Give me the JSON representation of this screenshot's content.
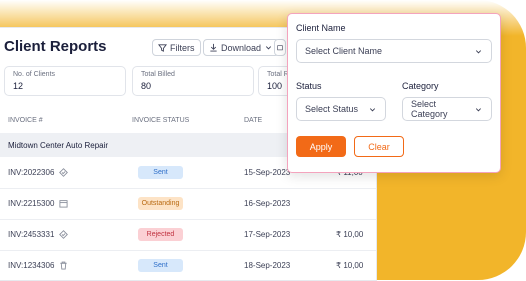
{
  "header": {
    "title": "Client Reports",
    "filters_label": "Filters",
    "download_label": "Download"
  },
  "stats": [
    {
      "label": "No. of Clients",
      "value": "12"
    },
    {
      "label": "Total Billed",
      "value": "80"
    },
    {
      "label": "Total R",
      "value": "100"
    }
  ],
  "table": {
    "columns": [
      "INVOICE #",
      "INVOICE STATUS",
      "DATE"
    ],
    "group": "Midtown Center Auto Repair",
    "rows": [
      {
        "invoice": "INV:2022306",
        "icon": "badge-check-icon",
        "status": "Sent",
        "date": "15-Sep-2023",
        "amount": "₹ 11,00"
      },
      {
        "invoice": "INV:2215300",
        "icon": "calendar-icon",
        "status": "Outstanding",
        "date": "16-Sep-2023",
        "amount": ""
      },
      {
        "invoice": "INV:2453331",
        "icon": "badge-check-icon",
        "status": "Rejected",
        "date": "17-Sep-2023",
        "amount": "₹ 10,00"
      },
      {
        "invoice": "INV:1234306",
        "icon": "trash-icon",
        "status": "Sent",
        "date": "18-Sep-2023",
        "amount": "₹ 10,00"
      }
    ]
  },
  "filter_popup": {
    "client_name_label": "Client Name",
    "client_name_placeholder": "Select Client Name",
    "status_label": "Status",
    "status_placeholder": "Select Status",
    "category_label": "Category",
    "category_placeholder": "Select Category",
    "apply_label": "Apply",
    "clear_label": "Clear"
  },
  "colors": {
    "background": "#F2B52A",
    "accent": "#F26A17"
  }
}
